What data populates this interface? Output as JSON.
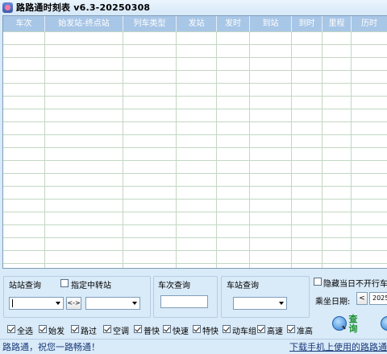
{
  "title": "路路通时刻表 v6.3-20250308",
  "table": {
    "headers": [
      "车次",
      "始发站-终点站",
      "列车类型",
      "发站",
      "发时",
      "到站",
      "到时",
      "里程",
      "历时"
    ]
  },
  "station_query": {
    "label": "站站查询",
    "transfer_label": "指定中转站",
    "swap_label": "<->"
  },
  "train_query": {
    "label": "车次查询"
  },
  "station_search": {
    "label": "车站查询"
  },
  "hide_label": "隐藏当日不开行车次",
  "date": {
    "label": "乘坐日期:",
    "prev": "<",
    "value": "2025-"
  },
  "filters": [
    {
      "label": "全选",
      "checked": true
    },
    {
      "label": "始发",
      "checked": true
    },
    {
      "label": "路过",
      "checked": true
    },
    {
      "label": "空调",
      "checked": true
    },
    {
      "label": "普快",
      "checked": true
    },
    {
      "label": "快速",
      "checked": true
    },
    {
      "label": "特快",
      "checked": true
    },
    {
      "label": "动车组",
      "checked": true
    },
    {
      "label": "高速",
      "checked": true
    },
    {
      "label": "准高",
      "checked": true
    }
  ],
  "query_button": {
    "line1": "查",
    "line2": "询"
  },
  "status": {
    "left": "路路通，祝您一路畅通！",
    "right": "下载手机上使用的路路通"
  }
}
